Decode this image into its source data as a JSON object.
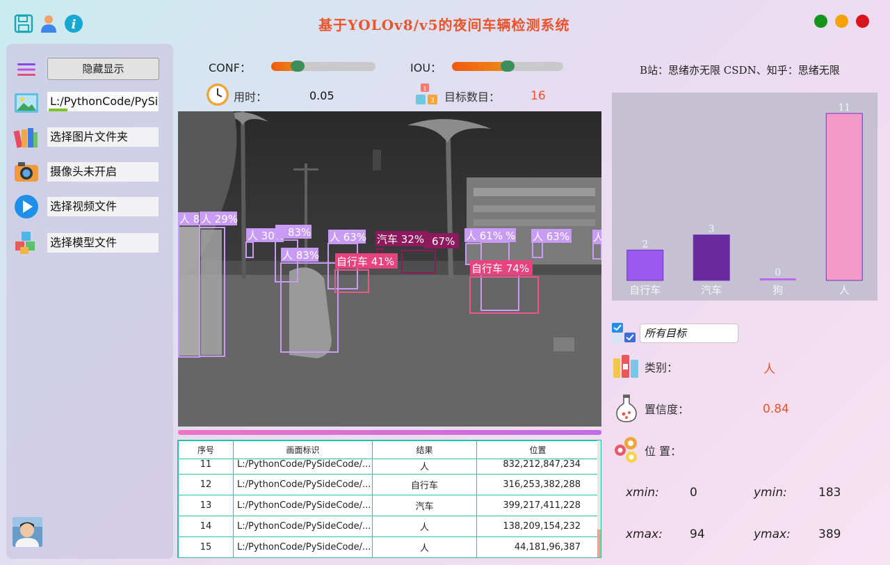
{
  "window": {
    "title": "基于YOLOv8/v5的夜间车辆检测系统",
    "icons": [
      "save-icon",
      "user-icon",
      "info-icon"
    ],
    "controls": {
      "green": "#14951a",
      "orange": "#f5a10a",
      "red": "#d8141c"
    }
  },
  "sidebar": {
    "hide_button": "隐藏显示",
    "path_value": "L:/PythonCode/PySide",
    "path_progress": 0.17,
    "items": [
      {
        "label": "选择图片文件夹",
        "icon": "books-icon"
      },
      {
        "label": "摄像头未开启",
        "icon": "camera-icon"
      },
      {
        "label": "选择视频文件",
        "icon": "play-icon"
      },
      {
        "label": "选择模型文件",
        "icon": "cubes-icon"
      }
    ]
  },
  "controls": {
    "conf_label": "CONF：",
    "conf_value": 0.25,
    "iou_label": "IOU：",
    "iou_value": 0.5,
    "time_label": "用时：",
    "time_value": "0.05",
    "count_label": "目标数目：",
    "count_value": "16"
  },
  "credits": "B站：思绪亦无限  CSDN、知乎：思绪无限",
  "detections": [
    {
      "label": "人 8",
      "conf": "",
      "box": "person"
    },
    {
      "label": "人 29%",
      "box": "person"
    },
    {
      "label": "人 30%",
      "box": "person"
    },
    {
      "label": "83%",
      "box": "person"
    },
    {
      "label": "人 83%",
      "box": "person"
    },
    {
      "label": "人 63%",
      "box": "person"
    },
    {
      "label": "自行车 41%",
      "box": "bicycle"
    },
    {
      "label": "汽车 32%",
      "box": "car"
    },
    {
      "label": "67%",
      "box": "car"
    },
    {
      "label": "人 61%",
      "box": "person"
    },
    {
      "label": "%",
      "box": "person"
    },
    {
      "label": "人 63%",
      "box": "person"
    },
    {
      "label": "自行车 74%",
      "box": "bicycle"
    },
    {
      "label": "人",
      "box": "person"
    }
  ],
  "table": {
    "headers": [
      "序号",
      "画面标识",
      "结果",
      "位置"
    ],
    "rows": [
      {
        "no": "11",
        "path": "L:/PythonCode/PySideCode/...",
        "result": "人",
        "pos": "832,212,847,234"
      },
      {
        "no": "12",
        "path": "L:/PythonCode/PySideCode/...",
        "result": "自行车",
        "pos": "316,253,382,288"
      },
      {
        "no": "13",
        "path": "L:/PythonCode/PySideCode/...",
        "result": "汽车",
        "pos": "399,217,411,228"
      },
      {
        "no": "14",
        "path": "L:/PythonCode/PySideCode/...",
        "result": "人",
        "pos": "138,209,154,232"
      },
      {
        "no": "15",
        "path": "L:/PythonCode/PySideCode/...",
        "result": "人",
        "pos": "44,181,96,387"
      }
    ]
  },
  "chart_data": {
    "type": "bar",
    "categories": [
      "自行车",
      "汽车",
      "狗",
      "人"
    ],
    "values": [
      2,
      3,
      0,
      11
    ],
    "colors": [
      "#9b59f0",
      "#6a2a9c",
      "#b968f2",
      "#f49ac8"
    ],
    "ylim": [
      0,
      11
    ]
  },
  "detail": {
    "filter_value": "所有目标",
    "class_label": "类别：",
    "class_value": "人",
    "conf_label": "置信度：",
    "conf_value": "0.84",
    "pos_label": "位 置：",
    "xmin_label": "xmin:",
    "xmin": "0",
    "ymin_label": "ymin:",
    "ymin": "183",
    "xmax_label": "xmax:",
    "xmax": "94",
    "ymax_label": "ymax:",
    "ymax": "389"
  }
}
